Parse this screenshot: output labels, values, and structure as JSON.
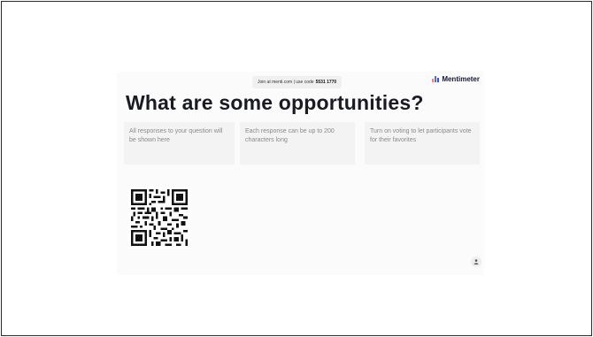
{
  "header": {
    "join_text": "Join at menti.com | use code",
    "join_code": "5531 1770",
    "brand": "Mentimeter"
  },
  "slide": {
    "question": "What are some opportunities?",
    "hints": [
      "All responses to your question will be shown here",
      "Each response can be up to 200 characters long",
      "Turn on voting to let participants vote for their favorites"
    ]
  },
  "icons": {
    "brand_icon": "bar-chart-icon",
    "qr": "qr-code",
    "participants": "person-icon"
  },
  "colors": {
    "background": "#ffffff",
    "slide": "#fbfbfb",
    "hint_box": "#f3f3f3",
    "hint_text": "#8a8a8a",
    "title": "#1a1a24",
    "brand_blue": "#5769e7"
  }
}
